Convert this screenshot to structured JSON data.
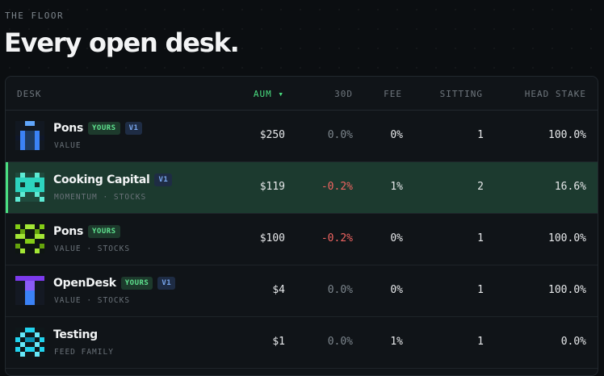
{
  "header": {
    "eyebrow": "THE FLOOR",
    "title": "Every open desk."
  },
  "table": {
    "columns": {
      "desk": "DESK",
      "aum": "AUM ▾",
      "d30": "30D",
      "fee": "FEE",
      "sitting": "SITTING",
      "stake": "HEAD STAKE"
    },
    "rows": [
      {
        "name": "Pons",
        "yours": "YOURS",
        "version": "V1",
        "tags": "VALUE",
        "aum": "$250",
        "d30": "0.0%",
        "fee": "0%",
        "sitting": "1",
        "stake": "100.0%"
      },
      {
        "name": "Cooking Capital",
        "yours": "",
        "version": "V1",
        "tags": "MOMENTUM · STOCKS",
        "aum": "$119",
        "d30": "-0.2%",
        "fee": "1%",
        "sitting": "2",
        "stake": "16.6%"
      },
      {
        "name": "Pons",
        "yours": "YOURS",
        "version": "",
        "tags": "VALUE · STOCKS",
        "aum": "$100",
        "d30": "-0.2%",
        "fee": "0%",
        "sitting": "1",
        "stake": "100.0%"
      },
      {
        "name": "OpenDesk",
        "yours": "YOURS",
        "version": "V1",
        "tags": "VALUE · STOCKS",
        "aum": "$4",
        "d30": "0.0%",
        "fee": "0%",
        "sitting": "1",
        "stake": "100.0%"
      },
      {
        "name": "Testing",
        "yours": "",
        "version": "",
        "tags": "FEED FAMILY",
        "aum": "$1",
        "d30": "0.0%",
        "fee": "1%",
        "sitting": "1",
        "stake": "0.0%"
      }
    ]
  },
  "colors": {
    "accent": "#4ade80",
    "negative": "#ef6461",
    "active_row": "#1c3a2f",
    "badge_yours": "#1d3a2c",
    "badge_version": "#1e2c44"
  },
  "icons": [
    "pixel-avatar-blue-bars",
    "pixel-avatar-teal-invader",
    "pixel-avatar-green-checker",
    "pixel-avatar-purple-t",
    "pixel-avatar-cyan-dots"
  ]
}
